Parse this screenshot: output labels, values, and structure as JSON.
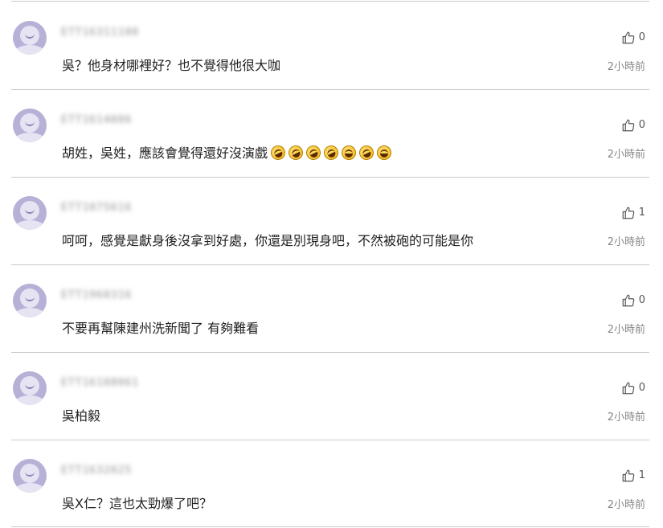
{
  "comments": [
    {
      "username": "ETT16311100",
      "text": "吳？他身材哪裡好？也不覺得他很大咖",
      "emojis": [],
      "likes": "0",
      "time": "2小時前"
    },
    {
      "username": "ETT1614086",
      "text": "胡姓，吳姓，應該會覺得還好沒演戲",
      "emojis": [
        "rofl",
        "rofl",
        "rofl",
        "rofl",
        "grin",
        "rofl",
        "grin"
      ],
      "likes": "0",
      "time": "2小時前"
    },
    {
      "username": "ETT1075616",
      "text": "呵呵，感覺是獻身後沒拿到好處，你還是別現身吧，不然被砲的可能是你",
      "emojis": [],
      "likes": "1",
      "time": "2小時前"
    },
    {
      "username": "ETT1960316",
      "text": "不要再幫陳建州洗新聞了 有夠難看",
      "emojis": [],
      "likes": "0",
      "time": "2小時前"
    },
    {
      "username": "ETT16108061",
      "text": "吳柏毅",
      "emojis": [],
      "likes": "0",
      "time": "2小時前"
    },
    {
      "username": "ETT1632025",
      "text": "吳X仁？這也太勁爆了吧？",
      "emojis": [],
      "likes": "1",
      "time": "2小時前"
    }
  ]
}
